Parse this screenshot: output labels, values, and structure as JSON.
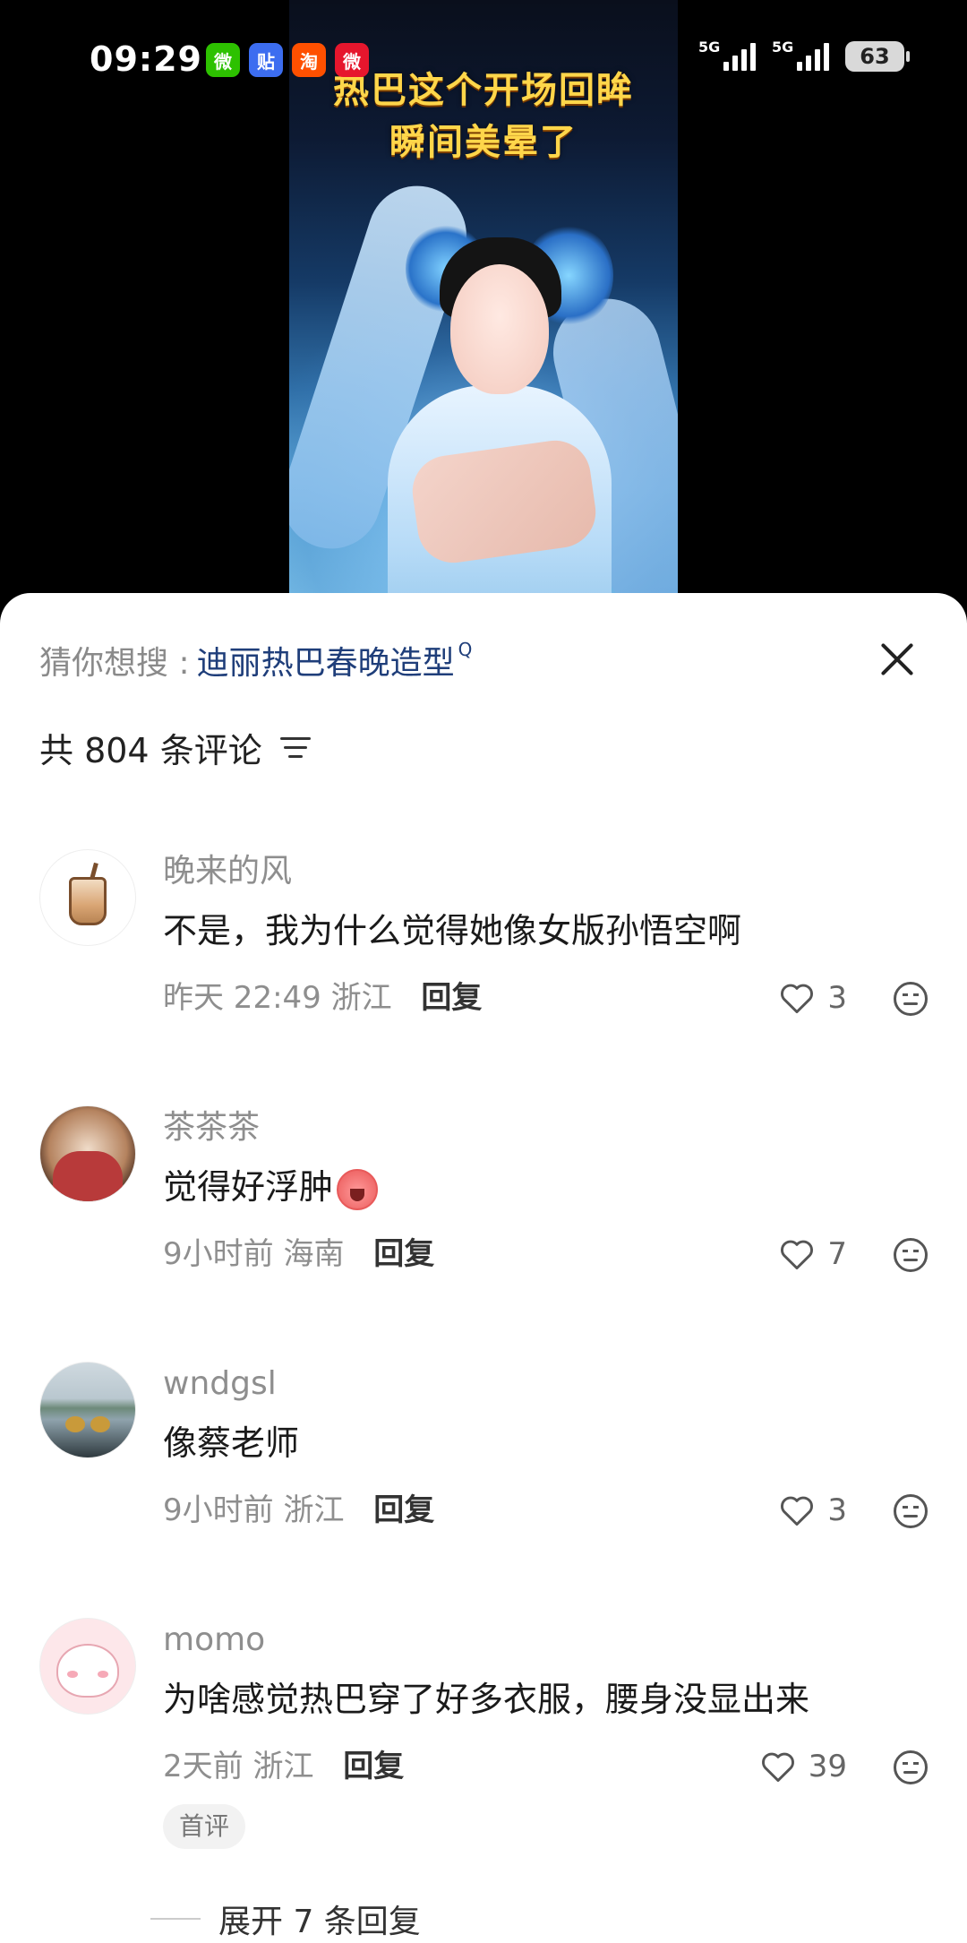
{
  "status_bar": {
    "time": "09:29",
    "app_icons": [
      {
        "name": "wechat-icon",
        "glyph": "微"
      },
      {
        "name": "tieba-icon",
        "glyph": "贴"
      },
      {
        "name": "taobao-icon",
        "glyph": "淘"
      },
      {
        "name": "weibo-icon",
        "glyph": "微"
      }
    ],
    "signal_1": "5G",
    "signal_2": "5G",
    "battery": "63"
  },
  "video": {
    "caption_line1": "热巴这个开场回眸",
    "caption_line2": "瞬间美晕了"
  },
  "search": {
    "label": "猜你想搜 :",
    "term": "迪丽热巴春晚造型",
    "term_icon": "Q"
  },
  "comments_header": {
    "count_text": "共 804 条评论"
  },
  "comments": [
    {
      "user": "晚来的风",
      "text": "不是，我为什么觉得她像女版孙悟空啊",
      "meta": "昨天 22:49 浙江",
      "reply": "回复",
      "likes": "3",
      "avatar": "milk-tea-avatar"
    },
    {
      "user": "茶茶茶",
      "text": "觉得好浮肿",
      "meta": "9小时前 海南",
      "reply": "回复",
      "likes": "7",
      "avatar": "dog-avatar"
    },
    {
      "user": "wndgsl",
      "text": "像蔡老师",
      "meta": "9小时前 浙江",
      "reply": "回复",
      "likes": "3",
      "avatar": "lake-avatar"
    },
    {
      "user": "momo",
      "text": "为啥感觉热巴穿了好多衣服，腰身没显出来",
      "meta": "2天前 浙江",
      "reply": "回复",
      "likes": "39",
      "badge": "首评",
      "avatar": "cartoon-avatar"
    }
  ],
  "expand_replies": "展开 7 条回复"
}
